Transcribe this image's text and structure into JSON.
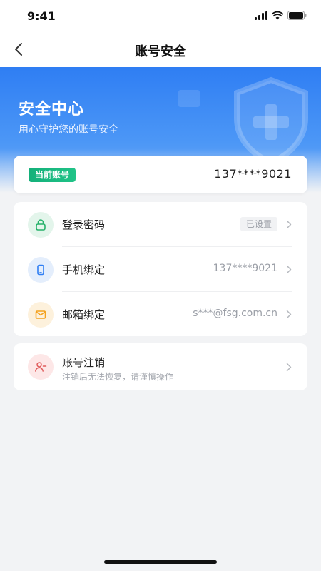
{
  "status_bar": {
    "time": "9:41"
  },
  "nav": {
    "title": "账号安全"
  },
  "hero": {
    "title": "安全中心",
    "subtitle": "用心守护您的账号安全"
  },
  "account": {
    "badge": "当前账号",
    "number": "137****9021"
  },
  "security_list": [
    {
      "label": "登录密码",
      "value": "已设置",
      "icon": "lock-icon"
    },
    {
      "label": "手机绑定",
      "value": "137****9021",
      "icon": "phone-icon"
    },
    {
      "label": "邮箱绑定",
      "value": "s***@fsg.com.cn",
      "icon": "mail-icon"
    }
  ],
  "cancel": {
    "label": "账号注销",
    "description": "注销后无法恢复，请谨慎操作",
    "icon": "user-minus-icon"
  },
  "colors": {
    "accent_blue": "#2f7ef3",
    "badge_green": "#14b07a",
    "lock_green": "#27b26b",
    "phone_blue": "#2f7ef3",
    "mail_orange": "#f4a21e",
    "cancel_red": "#e05a5a"
  }
}
